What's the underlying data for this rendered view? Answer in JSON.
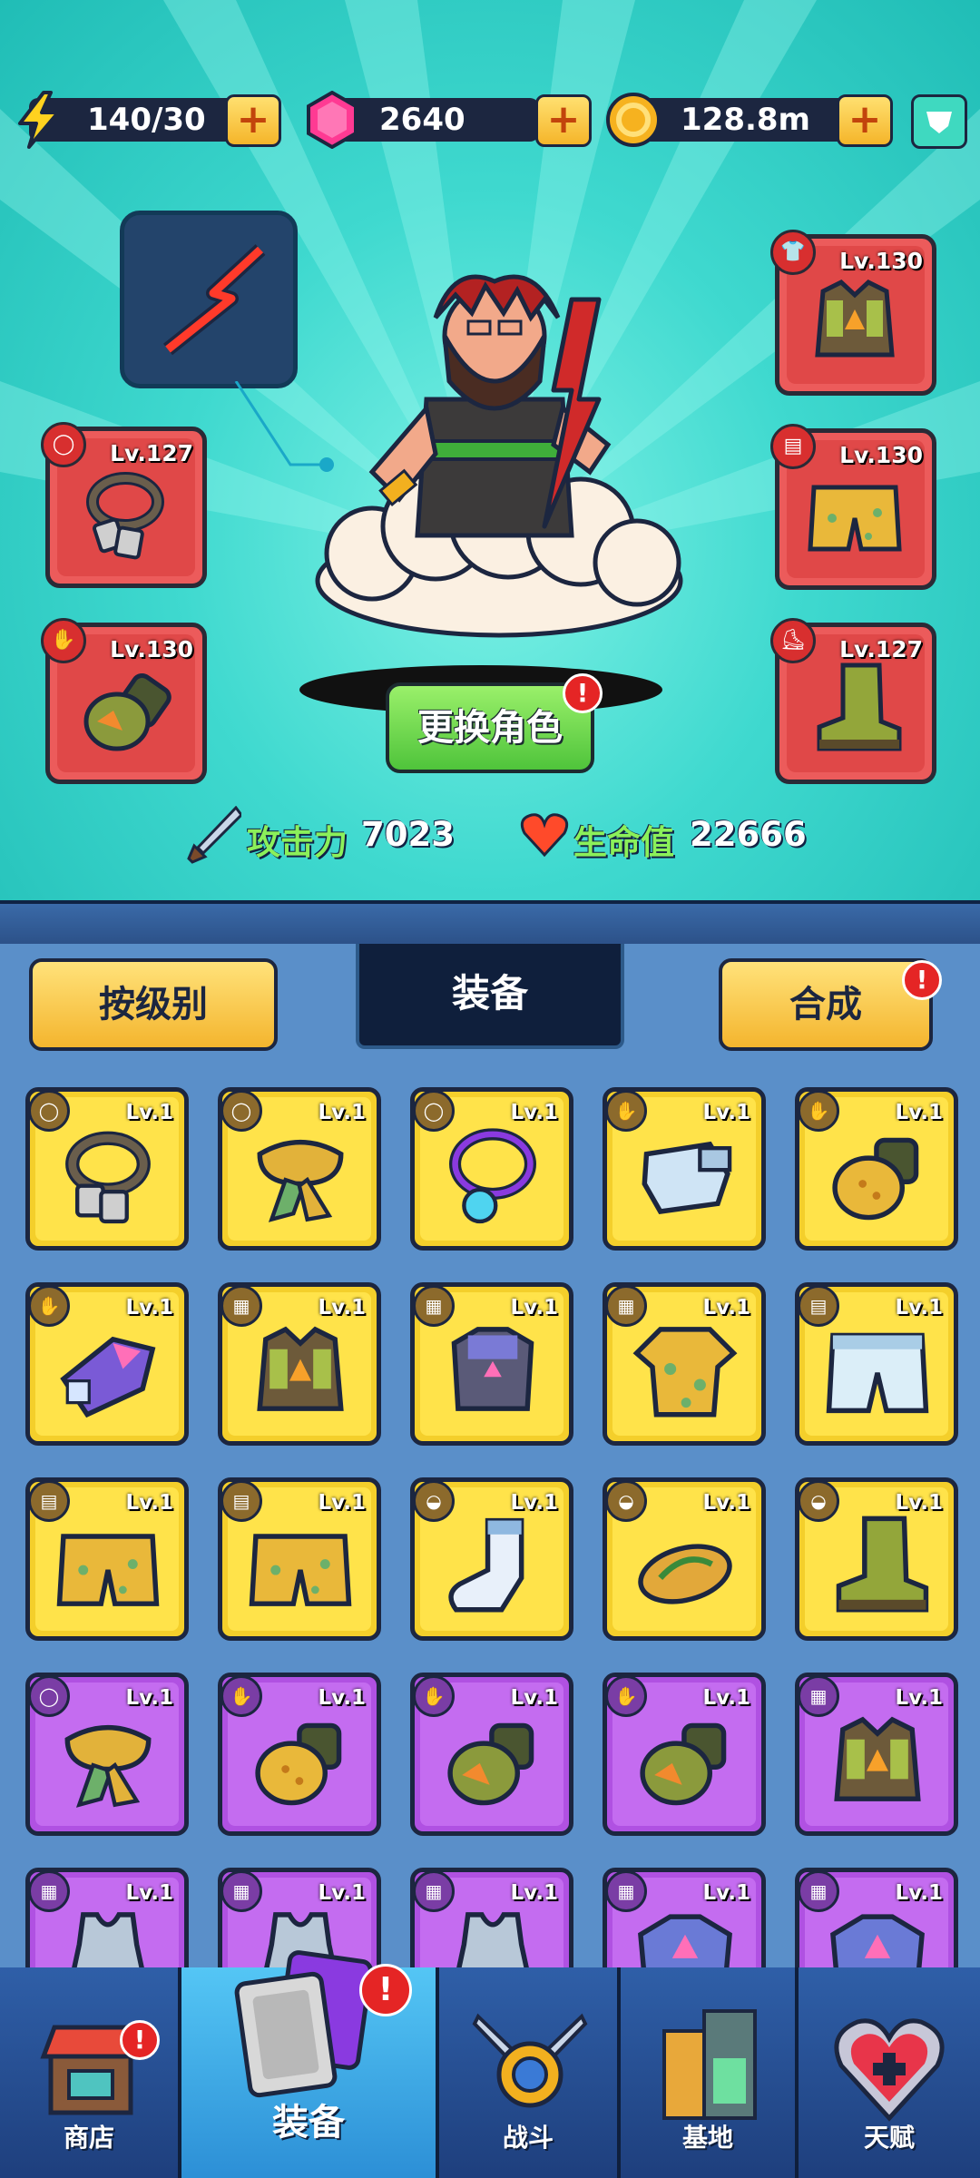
{
  "resources": {
    "energy": "140/30",
    "gems": "2640",
    "coins": "128.8m"
  },
  "hero": {
    "slots_left": [
      {
        "level": "Lv.127",
        "item": "dogtag-necklace-icon"
      },
      {
        "level": "Lv.130",
        "item": "gauntlet-icon"
      }
    ],
    "slots_right": [
      {
        "level": "Lv.130",
        "item": "armor-vest-icon"
      },
      {
        "level": "Lv.130",
        "item": "shorts-icon"
      },
      {
        "level": "Lv.127",
        "item": "boots-icon"
      }
    ],
    "change_character_label": "更换角色",
    "change_character_alert": "!"
  },
  "stats": {
    "attack_label": "攻击力",
    "attack_value": "7023",
    "hp_label": "生命值",
    "hp_value": "22666"
  },
  "tabs": {
    "sort_label": "按级别",
    "center_label": "装备",
    "merge_label": "合成",
    "merge_alert": "!"
  },
  "inventory": [
    {
      "level": "Lv.1",
      "rarity": "yellow",
      "icon": "dogtag-necklace-icon"
    },
    {
      "level": "Lv.1",
      "rarity": "yellow",
      "icon": "scarf-icon"
    },
    {
      "level": "Lv.1",
      "rarity": "yellow",
      "icon": "gem-necklace-icon"
    },
    {
      "level": "Lv.1",
      "rarity": "yellow",
      "icon": "glove-icon"
    },
    {
      "level": "Lv.1",
      "rarity": "yellow",
      "icon": "gauntlet-icon"
    },
    {
      "level": "Lv.1",
      "rarity": "yellow",
      "icon": "tech-gauntlet-icon"
    },
    {
      "level": "Lv.1",
      "rarity": "yellow",
      "icon": "armor-vest-icon"
    },
    {
      "level": "Lv.1",
      "rarity": "yellow",
      "icon": "mech-armor-icon"
    },
    {
      "level": "Lv.1",
      "rarity": "yellow",
      "icon": "hawaiian-shirt-icon"
    },
    {
      "level": "Lv.1",
      "rarity": "yellow",
      "icon": "boxer-shorts-icon"
    },
    {
      "level": "Lv.1",
      "rarity": "yellow",
      "icon": "shorts-icon"
    },
    {
      "level": "Lv.1",
      "rarity": "yellow",
      "icon": "shorts-icon"
    },
    {
      "level": "Lv.1",
      "rarity": "yellow",
      "icon": "sock-icon"
    },
    {
      "level": "Lv.1",
      "rarity": "yellow",
      "icon": "flip-flop-icon"
    },
    {
      "level": "Lv.1",
      "rarity": "yellow",
      "icon": "boots-icon"
    },
    {
      "level": "Lv.1",
      "rarity": "purple",
      "icon": "scarf-icon"
    },
    {
      "level": "Lv.1",
      "rarity": "purple",
      "icon": "gauntlet-icon"
    },
    {
      "level": "Lv.1",
      "rarity": "purple",
      "icon": "fist-gauntlet-icon"
    },
    {
      "level": "Lv.1",
      "rarity": "purple",
      "icon": "fist-gauntlet-icon"
    },
    {
      "level": "Lv.1",
      "rarity": "purple",
      "icon": "armor-vest-icon"
    },
    {
      "level": "Lv.1",
      "rarity": "purple",
      "icon": "tank-top-icon"
    },
    {
      "level": "Lv.1",
      "rarity": "purple",
      "icon": "tank-top-icon"
    },
    {
      "level": "Lv.1",
      "rarity": "purple",
      "icon": "tank-top-icon"
    },
    {
      "level": "Lv.1",
      "rarity": "purple",
      "icon": "tech-armor-icon"
    },
    {
      "level": "Lv.1",
      "rarity": "purple",
      "icon": "tech-armor-icon"
    }
  ],
  "nav": {
    "shop": "商店",
    "equipment": "装备",
    "battle": "战斗",
    "base": "基地",
    "talent": "天赋",
    "shop_alert": "!",
    "equipment_alert": "!"
  },
  "colors": {
    "hero_bg": "#3fd9cf",
    "yellow_rarity": "#f4cf2b",
    "purple_rarity": "#b051e2",
    "slot_red": "#ec5b5b",
    "accent_green": "#8bf05a"
  }
}
